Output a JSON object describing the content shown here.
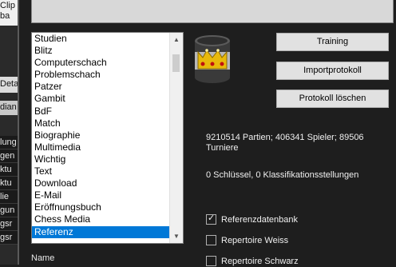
{
  "background_window": {
    "labels": [
      "Clip",
      "ba"
    ],
    "panel_items": [
      "Deta",
      "dian"
    ],
    "items": [
      "lung",
      "gen",
      "ktu",
      "ktu",
      "lie",
      "gun",
      "gsr",
      "gsr"
    ]
  },
  "category_list": {
    "items": [
      "Studien",
      "Blitz",
      "Computerschach",
      "Problemschach",
      "Patzer",
      "Gambit",
      "BdF",
      "Match",
      "Biographie",
      "Multimedia",
      "Wichtig",
      "Text",
      "Download",
      "E-Mail",
      "Eröffnungsbuch",
      "Chess Media",
      "Referenz"
    ],
    "selected": "Referenz"
  },
  "name_label": "Name",
  "buttons": {
    "training": "Training",
    "import_log": "Importprotokoll",
    "delete_log": "Protokoll löschen"
  },
  "stats_text": "9210514 Partien; 406341 Spieler; 89506 Turniere",
  "keys_text": "0 Schlüssel, 0 Klassifikationsstellungen",
  "checkboxes": {
    "reference_db": {
      "label": "Referenzdatenbank",
      "checked": true
    },
    "repertoire_white": {
      "label": "Repertoire Weiss",
      "checked": false
    },
    "repertoire_black": {
      "label": "Repertoire Schwarz",
      "checked": false
    }
  },
  "icons": {
    "database": "database-crown-icon",
    "scroll_up": "scroll-up-arrow-icon",
    "scroll_down": "scroll-down-arrow-icon",
    "check": "checkmark-icon"
  }
}
